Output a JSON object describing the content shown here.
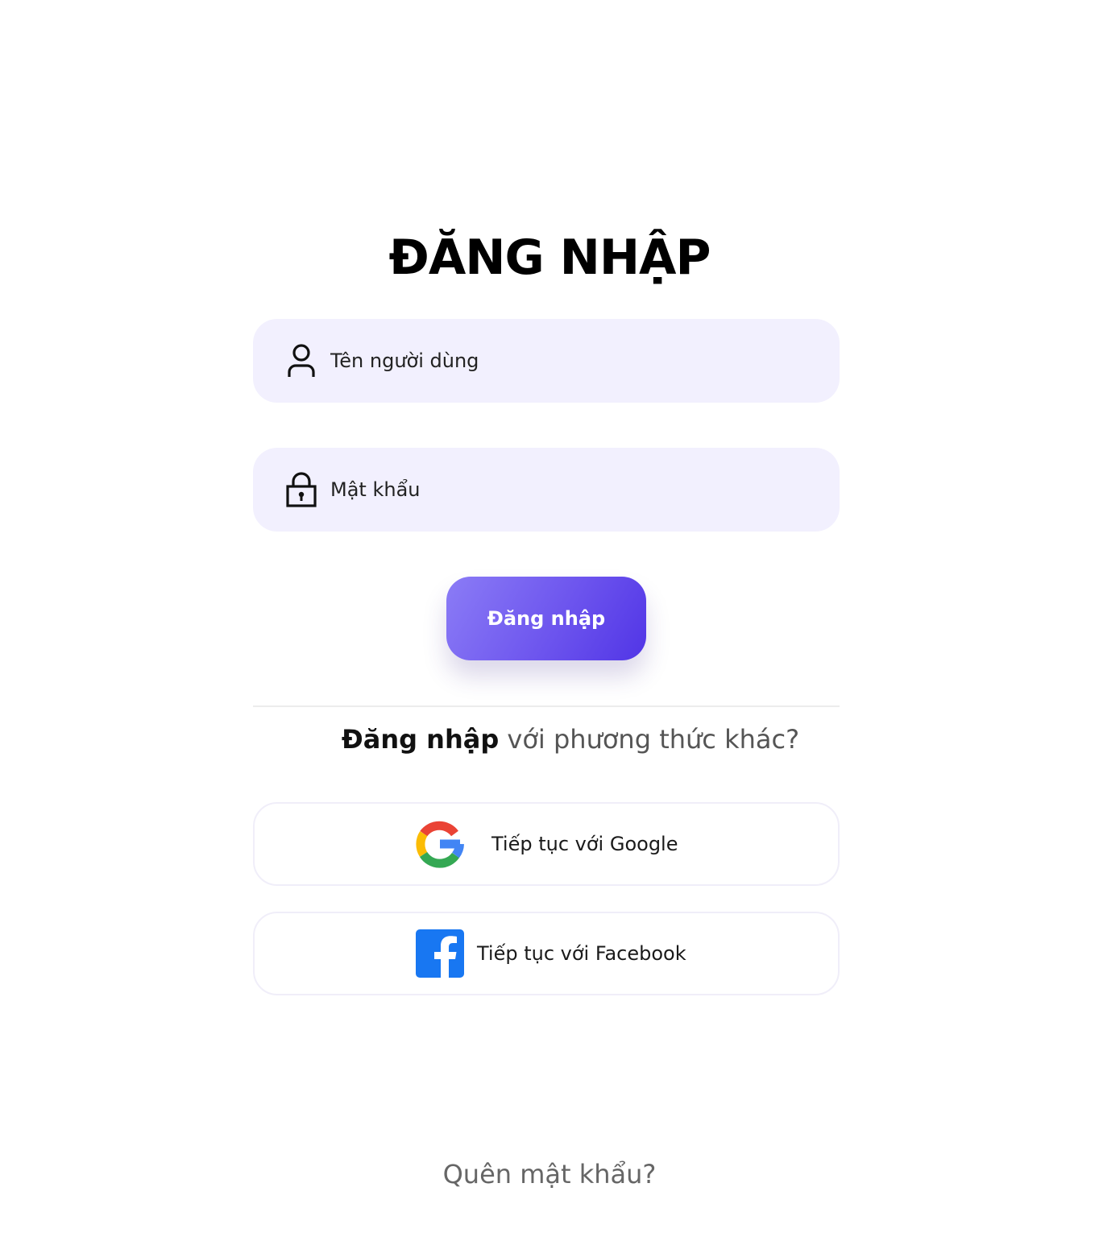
{
  "title": "ĐĂNG NHẬP",
  "username": {
    "placeholder": "Tên người dùng",
    "value": "",
    "icon": "user-icon"
  },
  "password": {
    "placeholder": "Mật khẩu",
    "value": "",
    "icon": "lock-icon"
  },
  "login_button": {
    "label": "Đăng nhập",
    "gradient_start": "#8b7cf6",
    "gradient_end": "#5135e6"
  },
  "alternative": {
    "strong": "Đăng nhập",
    "rest": " với phương thức khác?"
  },
  "social": {
    "google": {
      "label": "Tiếp tục với Google",
      "icon": "google-icon"
    },
    "facebook": {
      "label": "Tiếp tục với Facebook",
      "icon": "facebook-icon",
      "color": "#1877f2"
    }
  },
  "forgot_password": "Quên mật khẩu?",
  "colors": {
    "field_background": "#f2f0fe",
    "divider": "#ececec"
  }
}
